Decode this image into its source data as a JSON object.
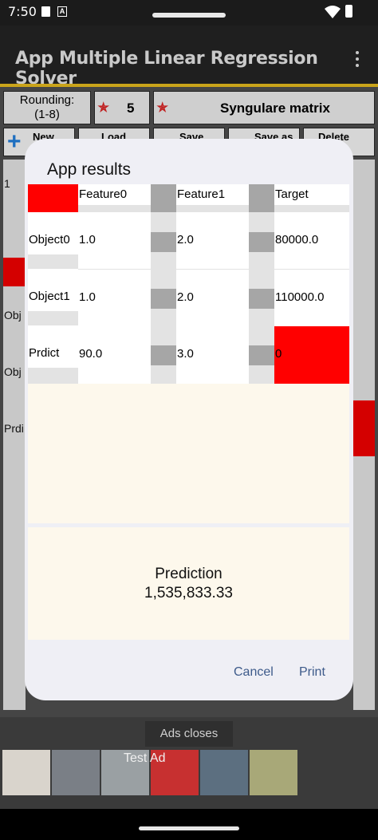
{
  "status": {
    "time": "7:50",
    "sd_icon": "sd-card-icon",
    "a_icon": "font-a-icon"
  },
  "app": {
    "title": "App Multiple Linear Regression Solver",
    "accent": "#caa41a"
  },
  "toolbar": {
    "rounding_label": "Rounding:\n(1-8)",
    "rounding_value": "5",
    "matrix_label": "Syngulare matrix",
    "new_label": "New",
    "load_label": "Load",
    "save_label": "Save",
    "saveas_label": "Save as",
    "delete_label": "Delete"
  },
  "background": {
    "row_labels": [
      "Obj",
      "Obj",
      "Prdi"
    ],
    "side_number": "1"
  },
  "dialog": {
    "title": "App results",
    "headers": [
      "Feature0",
      "Feature1",
      "Target"
    ],
    "rows": [
      {
        "label": "Object0",
        "f0": "1.0",
        "f1": "2.0",
        "target": "80000.0"
      },
      {
        "label": "Object1",
        "f0": "1.0",
        "f1": "2.0",
        "target": "110000.0"
      },
      {
        "label": "Prdict",
        "f0": "90.0",
        "f1": "3.0",
        "target": "0"
      }
    ],
    "prediction_label": "Prediction",
    "prediction_value": "1,535,833.33",
    "cancel_label": "Cancel",
    "print_label": "Print",
    "highlight_color": "#ff0000"
  },
  "ads": {
    "label": "Ads closes",
    "test_label": "Test Ad"
  }
}
